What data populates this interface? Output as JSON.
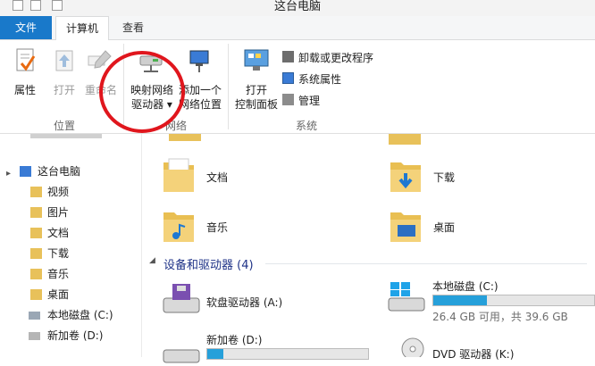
{
  "window": {
    "title": "这台电脑"
  },
  "tabs": {
    "file": "文件",
    "computer": "计算机",
    "view": "查看"
  },
  "ribbon": {
    "properties": "属性",
    "open": "打开",
    "rename": "重命名",
    "map_drive": [
      "映射网络",
      "驱动器"
    ],
    "add_location": [
      "添加一个",
      "网络位置"
    ],
    "control_panel": [
      "打开",
      "控制面板"
    ],
    "uninstall": "卸载或更改程序",
    "system_props": "系统属性",
    "manage": "管理",
    "groups": {
      "location": "位置",
      "network": "网络",
      "system": "系统"
    }
  },
  "nav": {
    "this_pc": "这台电脑",
    "items": [
      "视频",
      "图片",
      "文档",
      "下载",
      "音乐",
      "桌面",
      "本地磁盘 (C:)",
      "新加卷 (D:)"
    ]
  },
  "folders": [
    "文档",
    "下载",
    "音乐",
    "桌面"
  ],
  "devices": {
    "header": "设备和驱动器 (4)",
    "floppy": "软盘驱动器 (A:)",
    "c_drive": {
      "name": "本地磁盘 (C:)",
      "usage": "26.4 GB 可用，共 39.6 GB",
      "used_fraction": 0.333
    },
    "d_drive": {
      "name": "新加卷 (D:)",
      "used_fraction": 0.1
    },
    "dvd": {
      "name": "DVD 驱动器 (K:)"
    }
  },
  "colors": {
    "accent": "#1979ca",
    "highlight_circle": "#e0161d",
    "drive_fill": "#26a0da"
  }
}
